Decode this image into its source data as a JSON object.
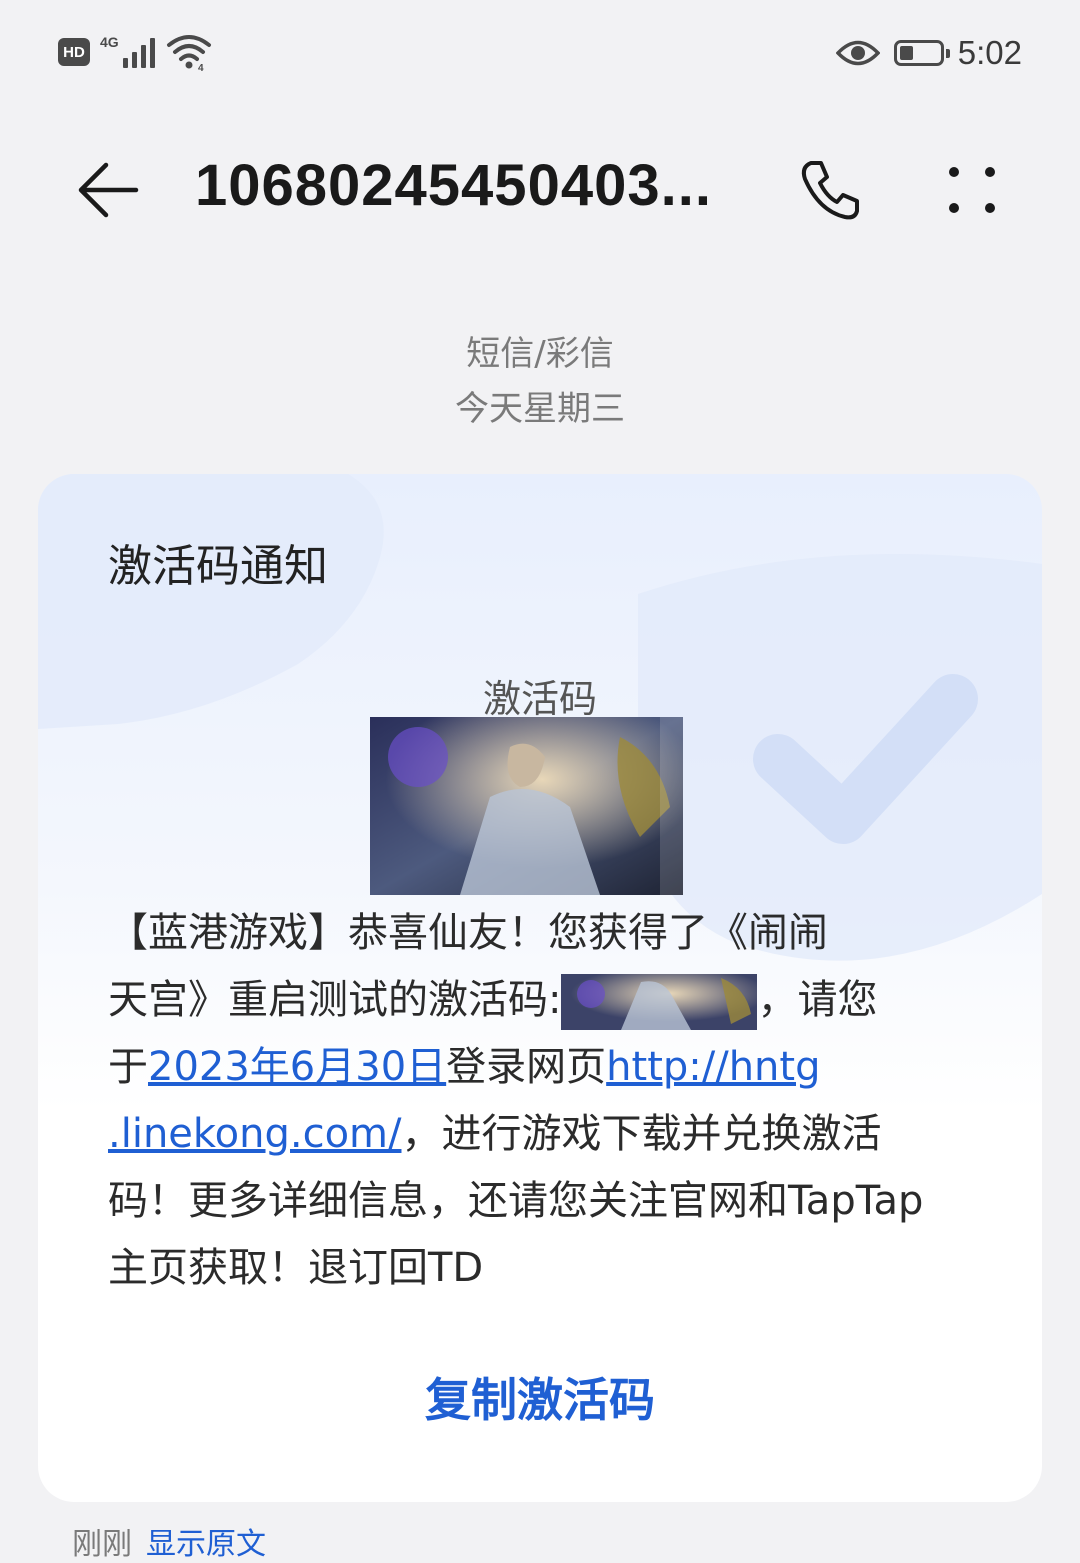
{
  "status_bar": {
    "hd": "HD",
    "network": "4G",
    "clock": "5:02",
    "battery_level": 0.35,
    "icons": [
      "hd-icon",
      "signal-icon",
      "wifi-icon",
      "eye-icon",
      "battery-icon"
    ]
  },
  "header": {
    "title": "10680245450403...",
    "back_icon": "arrow-left-icon",
    "call_icon": "phone-icon",
    "more_icon": "more-dots-icon"
  },
  "conversation": {
    "type": "短信/彩信",
    "date": "今天星期三"
  },
  "card": {
    "title": "激活码通知",
    "code_label": "激活码",
    "lines": [
      {
        "text": "【蓝港游戏】恭喜仙友！您获得了《闹闹"
      },
      {
        "before": "天宫》重启测试的激活码:",
        "after": "，请您"
      },
      {
        "before": "于",
        "date_link": "2023年6月30日",
        "middle": "登录网页",
        "url_part1": "http://hntg"
      },
      {
        "url_part2": ".linekong.com/",
        "after": "，进行游戏下载并兑换激活"
      },
      {
        "text": "码！更多详细信息，还请您关注官网和TapTap"
      },
      {
        "text": "主页获取！退订回TD"
      }
    ],
    "copy_button": "复制激活码"
  },
  "footer": {
    "time": "刚刚",
    "show_original": "显示原文"
  },
  "colors": {
    "accent": "#1f5fd3",
    "background": "#f2f2f4"
  }
}
